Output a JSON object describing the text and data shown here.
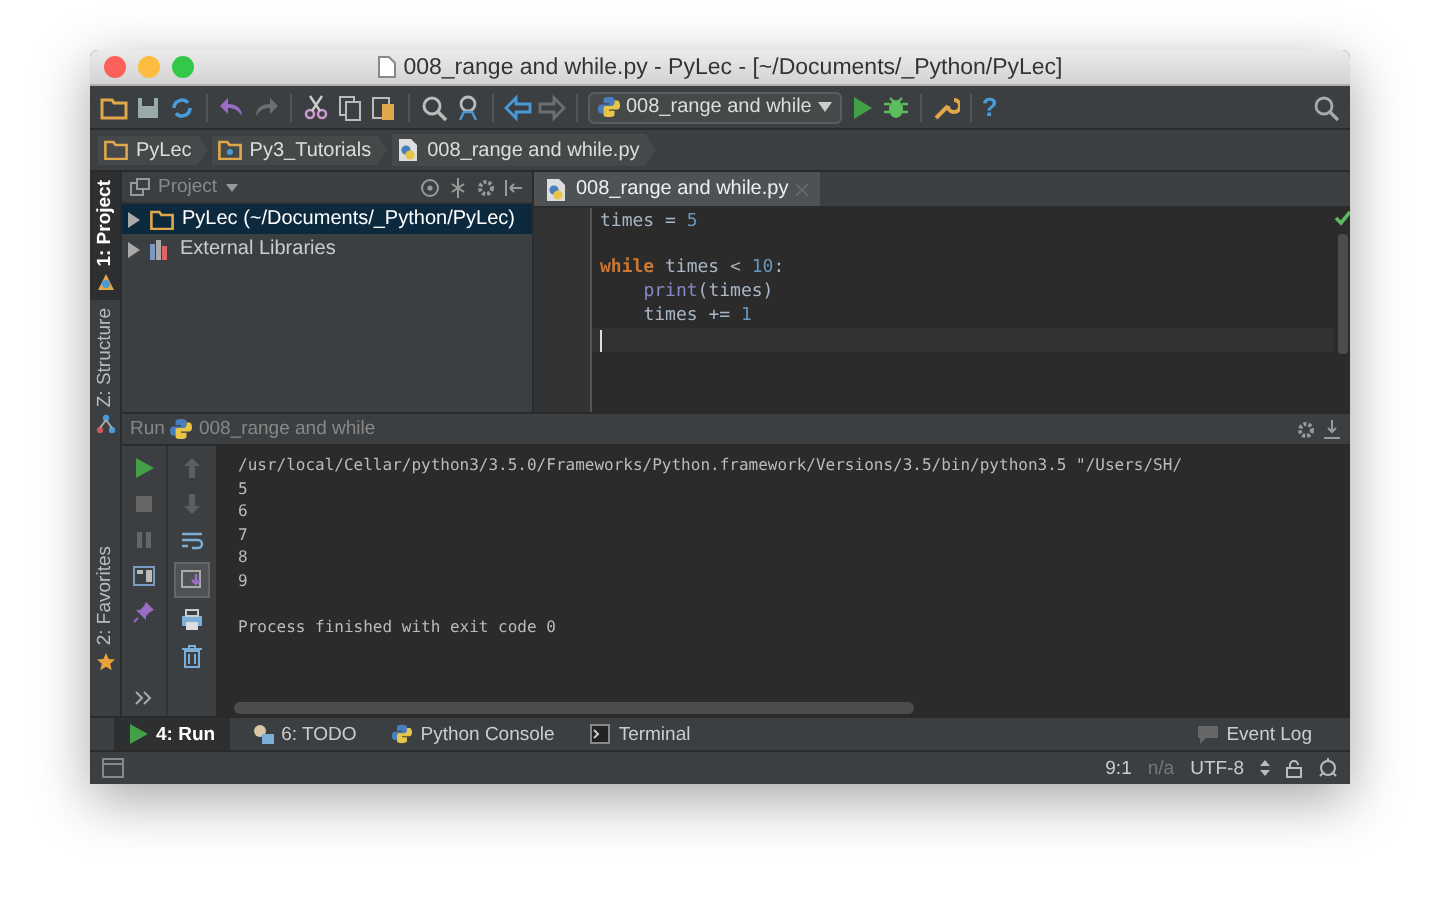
{
  "window": {
    "title": "008_range and while.py - PyLec - [~/Documents/_Python/PyLec]"
  },
  "toolbar": {
    "run_config": "008_range and while",
    "help": "?"
  },
  "breadcrumbs": [
    {
      "label": "PyLec",
      "kind": "folder"
    },
    {
      "label": "Py3_Tutorials",
      "kind": "package"
    },
    {
      "label": "008_range and while.py",
      "kind": "python"
    }
  ],
  "left_tabs_top": [
    {
      "label": "1: Project",
      "selected": true,
      "kind": "project"
    },
    {
      "label": "Z: Structure",
      "selected": false,
      "kind": "structure"
    }
  ],
  "left_tabs_bottom": [
    {
      "label": "2: Favorites",
      "selected": false,
      "kind": "favorites"
    }
  ],
  "project_panel": {
    "title": "Project",
    "tree": [
      {
        "label": "PyLec (~/Documents/_Python/PyLec)",
        "kind": "folder",
        "selected": true,
        "expanded": false
      },
      {
        "label": "External Libraries",
        "kind": "library",
        "selected": false,
        "expanded": false
      }
    ]
  },
  "editor": {
    "tabs": [
      {
        "label": "008_range and while.py",
        "selected": true
      }
    ],
    "lines": [
      {
        "current": false,
        "tokens": [
          {
            "text": "times = ",
            "kind": "plain"
          },
          {
            "text": "5",
            "kind": "number"
          }
        ]
      },
      {
        "current": false
      },
      {
        "current": false,
        "tokens": [
          {
            "text": "while",
            "kind": "keyword"
          },
          {
            "text": " times < ",
            "kind": "plain"
          },
          {
            "text": "10",
            "kind": "number"
          },
          {
            "text": ":",
            "kind": "plain"
          }
        ]
      },
      {
        "current": false,
        "indented": true,
        "tokens": [
          {
            "text": "print",
            "kind": "builtin"
          },
          {
            "text": "(times)",
            "kind": "plain"
          }
        ]
      },
      {
        "current": false,
        "indented": true,
        "tokens": [
          {
            "text": "times += ",
            "kind": "plain"
          },
          {
            "text": "1",
            "kind": "number"
          }
        ]
      },
      {
        "current": true
      }
    ]
  },
  "run_panel": {
    "title": "Run",
    "config": "008_range and while",
    "output": [
      {
        "text": "/usr/local/Cellar/python3/3.5.0/Frameworks/Python.framework/Versions/3.5/bin/python3.5 \"/Users/SH/",
        "kind": "command"
      },
      {
        "text": "5",
        "kind": "stdout"
      },
      {
        "text": "6",
        "kind": "stdout"
      },
      {
        "text": "7",
        "kind": "stdout"
      },
      {
        "text": "8",
        "kind": "stdout"
      },
      {
        "text": "9",
        "kind": "stdout"
      },
      {
        "text": "Process finished with exit code 0",
        "kind": "exit"
      }
    ]
  },
  "bottom_tabs": [
    {
      "label": "4: Run",
      "selected": true,
      "kind": "run"
    },
    {
      "label": "6: TODO",
      "selected": false,
      "kind": "todo"
    },
    {
      "label": "Python Console",
      "selected": false,
      "kind": "console"
    },
    {
      "label": "Terminal",
      "selected": false,
      "kind": "terminal"
    }
  ],
  "event_log": "Event Log",
  "status_bar": {
    "position": "9:1",
    "line_separator": "n/a",
    "encoding": "UTF-8"
  }
}
